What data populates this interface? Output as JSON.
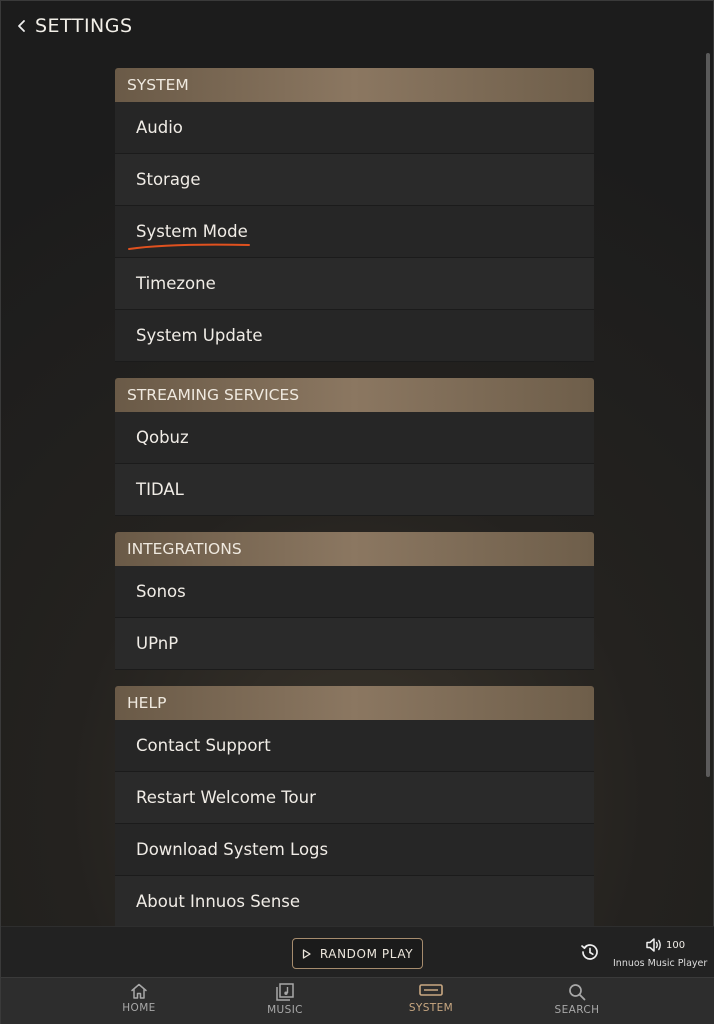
{
  "header": {
    "title": "SETTINGS",
    "back_icon": "chevron-left-icon"
  },
  "sections": [
    {
      "title": "SYSTEM",
      "items": [
        "Audio",
        "Storage",
        "System Mode",
        "Timezone",
        "System Update"
      ]
    },
    {
      "title": "STREAMING SERVICES",
      "items": [
        "Qobuz",
        "TIDAL"
      ]
    },
    {
      "title": "INTEGRATIONS",
      "items": [
        "Sonos",
        "UPnP"
      ]
    },
    {
      "title": "HELP",
      "items": [
        "Contact Support",
        "Restart Welcome Tour",
        "Download System Logs",
        "About Innuos Sense"
      ]
    }
  ],
  "annotation": {
    "underlined_item": "System Mode",
    "color": "#e0511f"
  },
  "player": {
    "random_play": "RANDOM PLAY",
    "volume": "100",
    "name": "Innuos Music Player"
  },
  "nav": [
    {
      "label": "HOME",
      "icon": "home-icon",
      "active": false
    },
    {
      "label": "MUSIC",
      "icon": "music-icon",
      "active": false
    },
    {
      "label": "SYSTEM",
      "icon": "system-icon",
      "active": true
    },
    {
      "label": "SEARCH",
      "icon": "search-icon",
      "active": false
    }
  ],
  "colors": {
    "accent": "#c9a882",
    "section_header": "#8b7761",
    "row_bg": "#262626"
  }
}
